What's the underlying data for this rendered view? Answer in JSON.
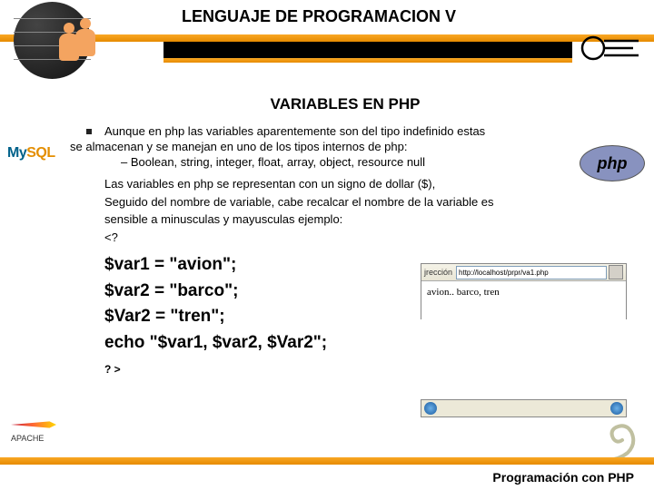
{
  "header": {
    "title": "LENGUAJE DE PROGRAMACION V"
  },
  "content": {
    "title": "VARIABLES EN PHP",
    "bullet1_part1": "Aunque en php las variables aparentemente son del tipo indefinido estas",
    "bullet1_part2": "se almacenan y se manejan en uno de los tipos internos de php:",
    "sub_bullet": "–   Boolean, string, integer, float, array, object, resource null",
    "para1": "Las variables en php se representan con un signo de dollar ($),",
    "para2": "Seguido del nombre de variable, cabe recalcar el nombre de la variable es",
    "para3": "sensible a minusculas y mayusculas ejemplo:",
    "code_open": "<?",
    "code_line1": "$var1 = \"avion\";",
    "code_line2": "$var2 = \"barco\";",
    "code_line3": "$Var2 = \"tren\";",
    "code_line4": "echo \"$var1, $var2, $Var2\";",
    "code_close": "? >"
  },
  "logos": {
    "mysql_my": "My",
    "mysql_sql": "SQL",
    "php": "php",
    "apache": "APACHE"
  },
  "browser": {
    "toolbar_label": "jrección",
    "url": "http://localhost/prpr/va1.php",
    "output": "avion.. barco, tren"
  },
  "footer": {
    "text": "Programación con PHP"
  }
}
